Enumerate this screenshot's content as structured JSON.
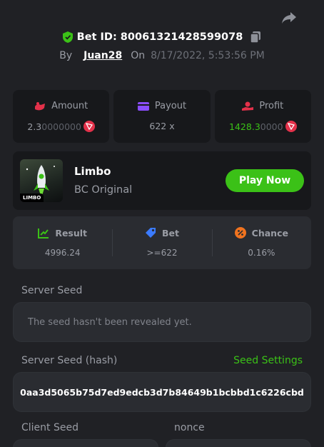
{
  "header": {
    "bet_id_label": "Bet ID: 80061321428599078",
    "by_label": "By",
    "username": "Juan28",
    "on_label": "On",
    "date": "8/17/2022, 5:53:56 PM"
  },
  "stats": {
    "amount_label": "Amount",
    "amount_main": "2.3",
    "amount_dim": "0000000",
    "payout_label": "Payout",
    "payout_value": "622 x",
    "profit_label": "Profit",
    "profit_main": "1428.3",
    "profit_dim": "0000"
  },
  "game": {
    "thumb_tag": "LIMBO",
    "name": "Limbo",
    "subtitle": "BC Original",
    "play_label": "Play Now"
  },
  "result": {
    "result_label": "Result",
    "result_value": "4996.24",
    "bet_label": "Bet",
    "bet_value": ">=622",
    "chance_label": "Chance",
    "chance_value": "0.16%"
  },
  "seeds": {
    "server_seed_label": "Server Seed",
    "server_seed_value": "The seed hasn't been revealed yet.",
    "server_hash_label": "Server Seed (hash)",
    "seed_settings_label": "Seed Settings",
    "server_hash_value": "0aa3d5065b75d7ed9edcb3d7b84649b1bcbbd1c6226cbd",
    "client_seed_label": "Client Seed",
    "nonce_label": "nonce"
  },
  "colors": {
    "accent_green": "#3bc117",
    "coin_red": "#e3314a",
    "background": "#202125"
  }
}
